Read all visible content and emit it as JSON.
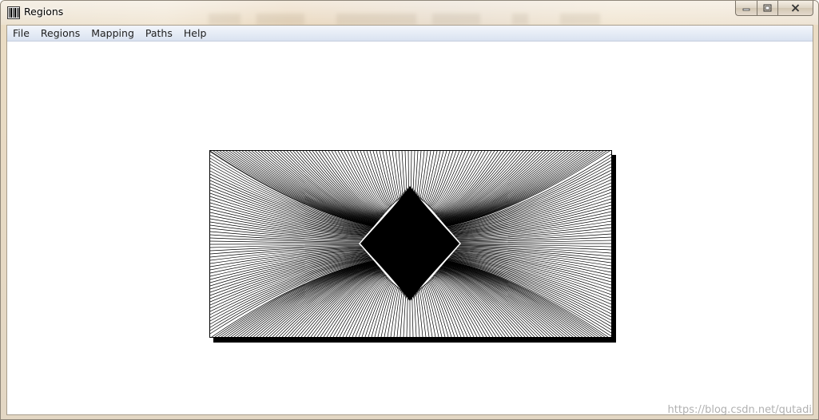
{
  "window": {
    "title": "Regions",
    "icon": "barcode-app-icon",
    "controls": {
      "minimize": "minimize-icon",
      "maximize": "maximize-icon",
      "close": "close-icon"
    }
  },
  "menu": {
    "items": [
      "File",
      "Regions",
      "Mapping",
      "Paths",
      "Help"
    ]
  },
  "canvas": {
    "figure": "line-field-with-dark-center",
    "colors": {
      "lines": "#000000",
      "background": "#ffffff",
      "shadow": "#000000"
    }
  },
  "watermark": {
    "text": "https://blog.csdn.net/qutadi"
  }
}
